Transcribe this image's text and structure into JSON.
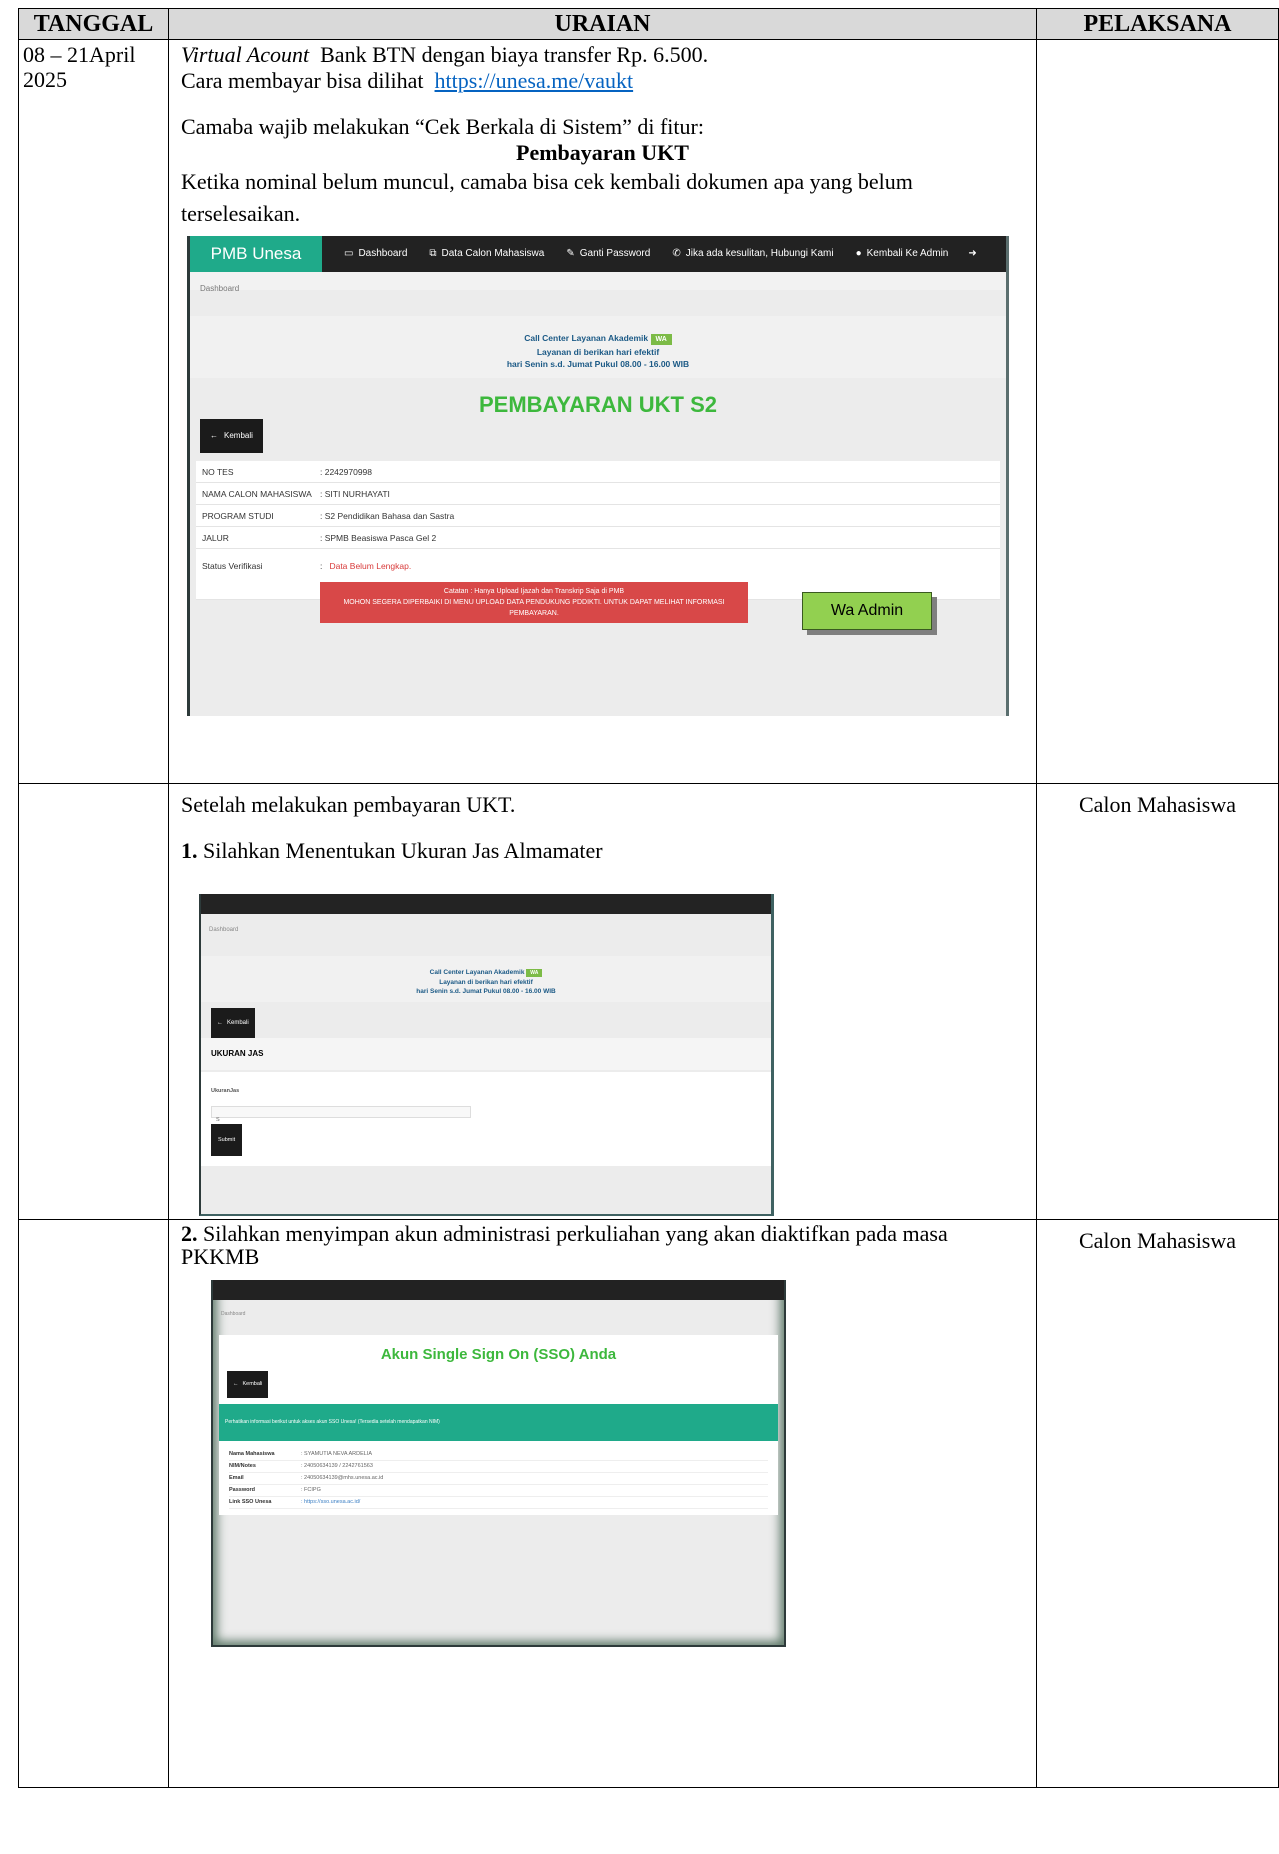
{
  "headers": {
    "tanggal": "TANGGAL",
    "uraian": "URAIAN",
    "pelaksana": "PELAKSANA"
  },
  "row1": {
    "tanggal_line1": "08 – 21April",
    "tanggal_line2": "2025",
    "va_italic": "Virtual Acount",
    "va_rest": "  Bank BTN dengan biaya transfer Rp. 6.500.",
    "cara": "Cara membayar bisa dilihat ",
    "link": "https://unesa.me/vaukt",
    "camaba": "Camaba wajib melakukan “Cek Berkala di Sistem” di fitur:",
    "pembayaran": "Pembayaran UKT",
    "ketika": "Ketika nominal belum muncul, camaba bisa cek kembali dokumen apa yang belum terselesaikan.",
    "screenshot": {
      "brand": "PMB Unesa",
      "nav": [
        "Dashboard",
        "Data Calon Mahasiswa",
        "Ganti Password",
        "Jika ada kesulitan, Hubungi Kami",
        "Kembali Ke Admin"
      ],
      "breadcrumb": "Dashboard",
      "cc_line1": "Call Center Layanan Akademik",
      "cc_wa": "WA",
      "cc_line2": "Layanan di berikan hari efektif",
      "cc_line3": "hari Senin s.d. Jumat Pukul 08.00 - 16.00 WIB",
      "title": "PEMBAYARAN UKT S2",
      "back": "Kembali",
      "rows": [
        {
          "k": "NO TES",
          "v": ":   2242970998"
        },
        {
          "k": "NAMA CALON MAHASISWA",
          "v": ":   SITI NURHAYATI"
        },
        {
          "k": "PROGRAM STUDI",
          "v": ":   S2 Pendidikan Bahasa dan Sastra"
        },
        {
          "k": "JALUR",
          "v": ":   SPMB Beasiswa Pasca Gel 2"
        }
      ],
      "status_k": "Status Verifikasi",
      "status_v": "Data Belum Lengkap.",
      "alert1": "Catatan : Hanya Upload Ijazah dan Transkrip Saja di PMB",
      "alert2": "MOHON SEGERA DIPERBAIKI DI MENU UPLOAD DATA PENDUKUNG PDDIKTI. UNTUK DAPAT MELIHAT INFORMASI PEMBAYARAN.",
      "wa_admin": "Wa Admin"
    }
  },
  "row2": {
    "setelah": "Setelah melakukan pembayaran UKT.",
    "num": "1.",
    "step": " Silahkan Menentukan Ukuran Jas Almamater",
    "pelaksana": "Calon Mahasiswa",
    "screenshot": {
      "breadcrumb": "Dashboard",
      "cc_line1": "Call Center Layanan Akademik",
      "cc_wa": "WA",
      "cc_line2": "Layanan di berikan hari efektif",
      "cc_line3": "hari Senin s.d. Jumat Pukul 08.00 - 16.00 WIB",
      "back": "Kembali",
      "heading": "UKURAN JAS",
      "label": "UkuranJas",
      "value": "S",
      "submit": "Submit"
    }
  },
  "row3": {
    "num": "2.",
    "step": " Silahkan menyimpan akun administrasi perkuliahan yang akan diaktifkan pada masa PKKMB",
    "pelaksana": "Calon Mahasiswa",
    "screenshot": {
      "breadcrumb": "Dashboard",
      "title": "Akun Single Sign On (SSO) Anda",
      "back": "Kembali",
      "notice": "Perhatikan informasi berikut untuk akses akun SSO Unesa! (Tersedia setelah mendapatkan NIM)",
      "rows": [
        {
          "k": "Nama Mahasiswa",
          "v": ": SYAMUTIA NEVA ARDELIA"
        },
        {
          "k": "NIM/Notes",
          "v": ": 24050634139 / 2242761563"
        },
        {
          "k": "Email",
          "v": ": 24050634139@mhs.unesa.ac.id"
        },
        {
          "k": "Password",
          "v": ": FCIPG"
        },
        {
          "k": "Link SSO Unesa",
          "v": ": https://sso.unesa.ac.id/"
        }
      ]
    }
  }
}
